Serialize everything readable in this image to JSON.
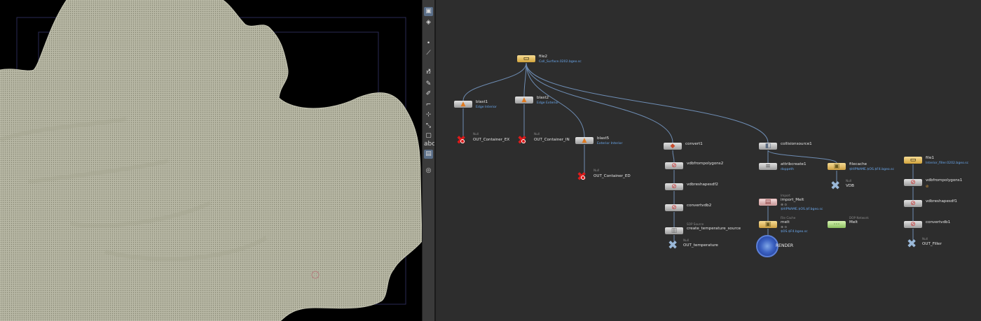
{
  "toolbar": {
    "tools": [
      {
        "name": "select-tool-icon",
        "glyph": "▣",
        "active": true
      },
      {
        "name": "view-tool-icon",
        "glyph": "◈",
        "active": false
      },
      {
        "name": "point-tool-icon",
        "glyph": "•",
        "active": false
      },
      {
        "name": "edge-tool-icon",
        "glyph": "⟋",
        "active": false
      },
      {
        "name": "pick-tool-icon",
        "glyph": "↗",
        "active": false
      },
      {
        "name": "number-tool-icon",
        "glyph": "¹²",
        "active": false
      },
      {
        "name": "paint-tool-icon",
        "glyph": "✎",
        "active": false
      },
      {
        "name": "brush-tool-icon",
        "glyph": "✐",
        "active": false
      },
      {
        "name": "crop-tool-icon",
        "glyph": "⌐",
        "active": false
      },
      {
        "name": "snap-tool-icon",
        "glyph": "⊹",
        "active": false
      },
      {
        "name": "transform-tool-icon",
        "glyph": "⤡",
        "active": false
      },
      {
        "name": "frame-tool-icon",
        "glyph": "▢",
        "active": false
      },
      {
        "name": "text-tool-label",
        "glyph": "abc",
        "active": false
      },
      {
        "name": "camera-tool-icon",
        "glyph": "▤",
        "active": true
      },
      {
        "name": "light-tool-icon",
        "glyph": "◎",
        "active": false
      }
    ]
  },
  "nodes": {
    "file2": {
      "name": "file2",
      "sub": "Coll_Surface.0202.bgeo.sc"
    },
    "blast1": {
      "name": "blast1",
      "sub": "Edge Interior"
    },
    "blast2": {
      "name": "blast2",
      "sub": "Edge Exterior"
    },
    "blast5": {
      "name": "blast5",
      "sub": "Exterior Interior"
    },
    "out_ex": {
      "type": "Null",
      "name": "OUT_Container_EX"
    },
    "out_in": {
      "type": "Null",
      "name": "OUT_Container_IN"
    },
    "out_ed": {
      "type": "Null",
      "name": "OUT_Container_ED"
    },
    "convert1": {
      "name": "convert1"
    },
    "vdbfrompolygons2": {
      "name": "vdbfrompolygons2"
    },
    "vdbreshapesdf2": {
      "name": "vdbreshapesdf2"
    },
    "convertvdb2": {
      "name": "convertvdb2"
    },
    "create_temperature_source": {
      "type": "SOP Source",
      "name": "create_temperature_source"
    },
    "out_temperature": {
      "type": "Null",
      "name": "OUT_temperature"
    },
    "collisionsource1": {
      "name": "collisionsource1"
    },
    "attribcreate1": {
      "name": "attribcreate1",
      "sub": "doppeth"
    },
    "import_melt": {
      "type": "Import",
      "name": "import_Melt",
      "flags": "⊕ ⊙",
      "sub": "$HIPNAME.$OS.$F.bgeo.sc"
    },
    "melt_cache": {
      "type": "File Cache",
      "name": "melt",
      "flags": "⊕ ⊙",
      "sub": "$OS.$F4.bgeo.sc"
    },
    "render": {
      "name": "RENDER"
    },
    "filecache": {
      "name": "filecache",
      "sub": "$HIPNAME.$OS.$F4.bgeo.sc"
    },
    "vdb": {
      "type": "Null",
      "name": "VDB"
    },
    "melt_network": {
      "type": "DOP Network",
      "name": "Melt"
    },
    "file1": {
      "name": "file1",
      "sub": "Interior_filler.0202.bgeo.sc"
    },
    "vdbfrompolygons1": {
      "name": "vdbfrompolygons1",
      "warn": "⊘"
    },
    "vdbreshapesdf1": {
      "name": "vdbreshapesdf1"
    },
    "convertvdb1": {
      "name": "convertvdb1"
    },
    "out_filler": {
      "type": "Null",
      "name": "OUT_Filler"
    }
  },
  "colors": {
    "viewport_bg": "#000000",
    "mesh_fill": "#b9b9a6",
    "mesh_line": "#8b8b78",
    "network_bg": "#2d2d2d",
    "wire": "#6e8db4",
    "null_red": "#dd1b1b",
    "link_blue": "#6aa8ee"
  }
}
